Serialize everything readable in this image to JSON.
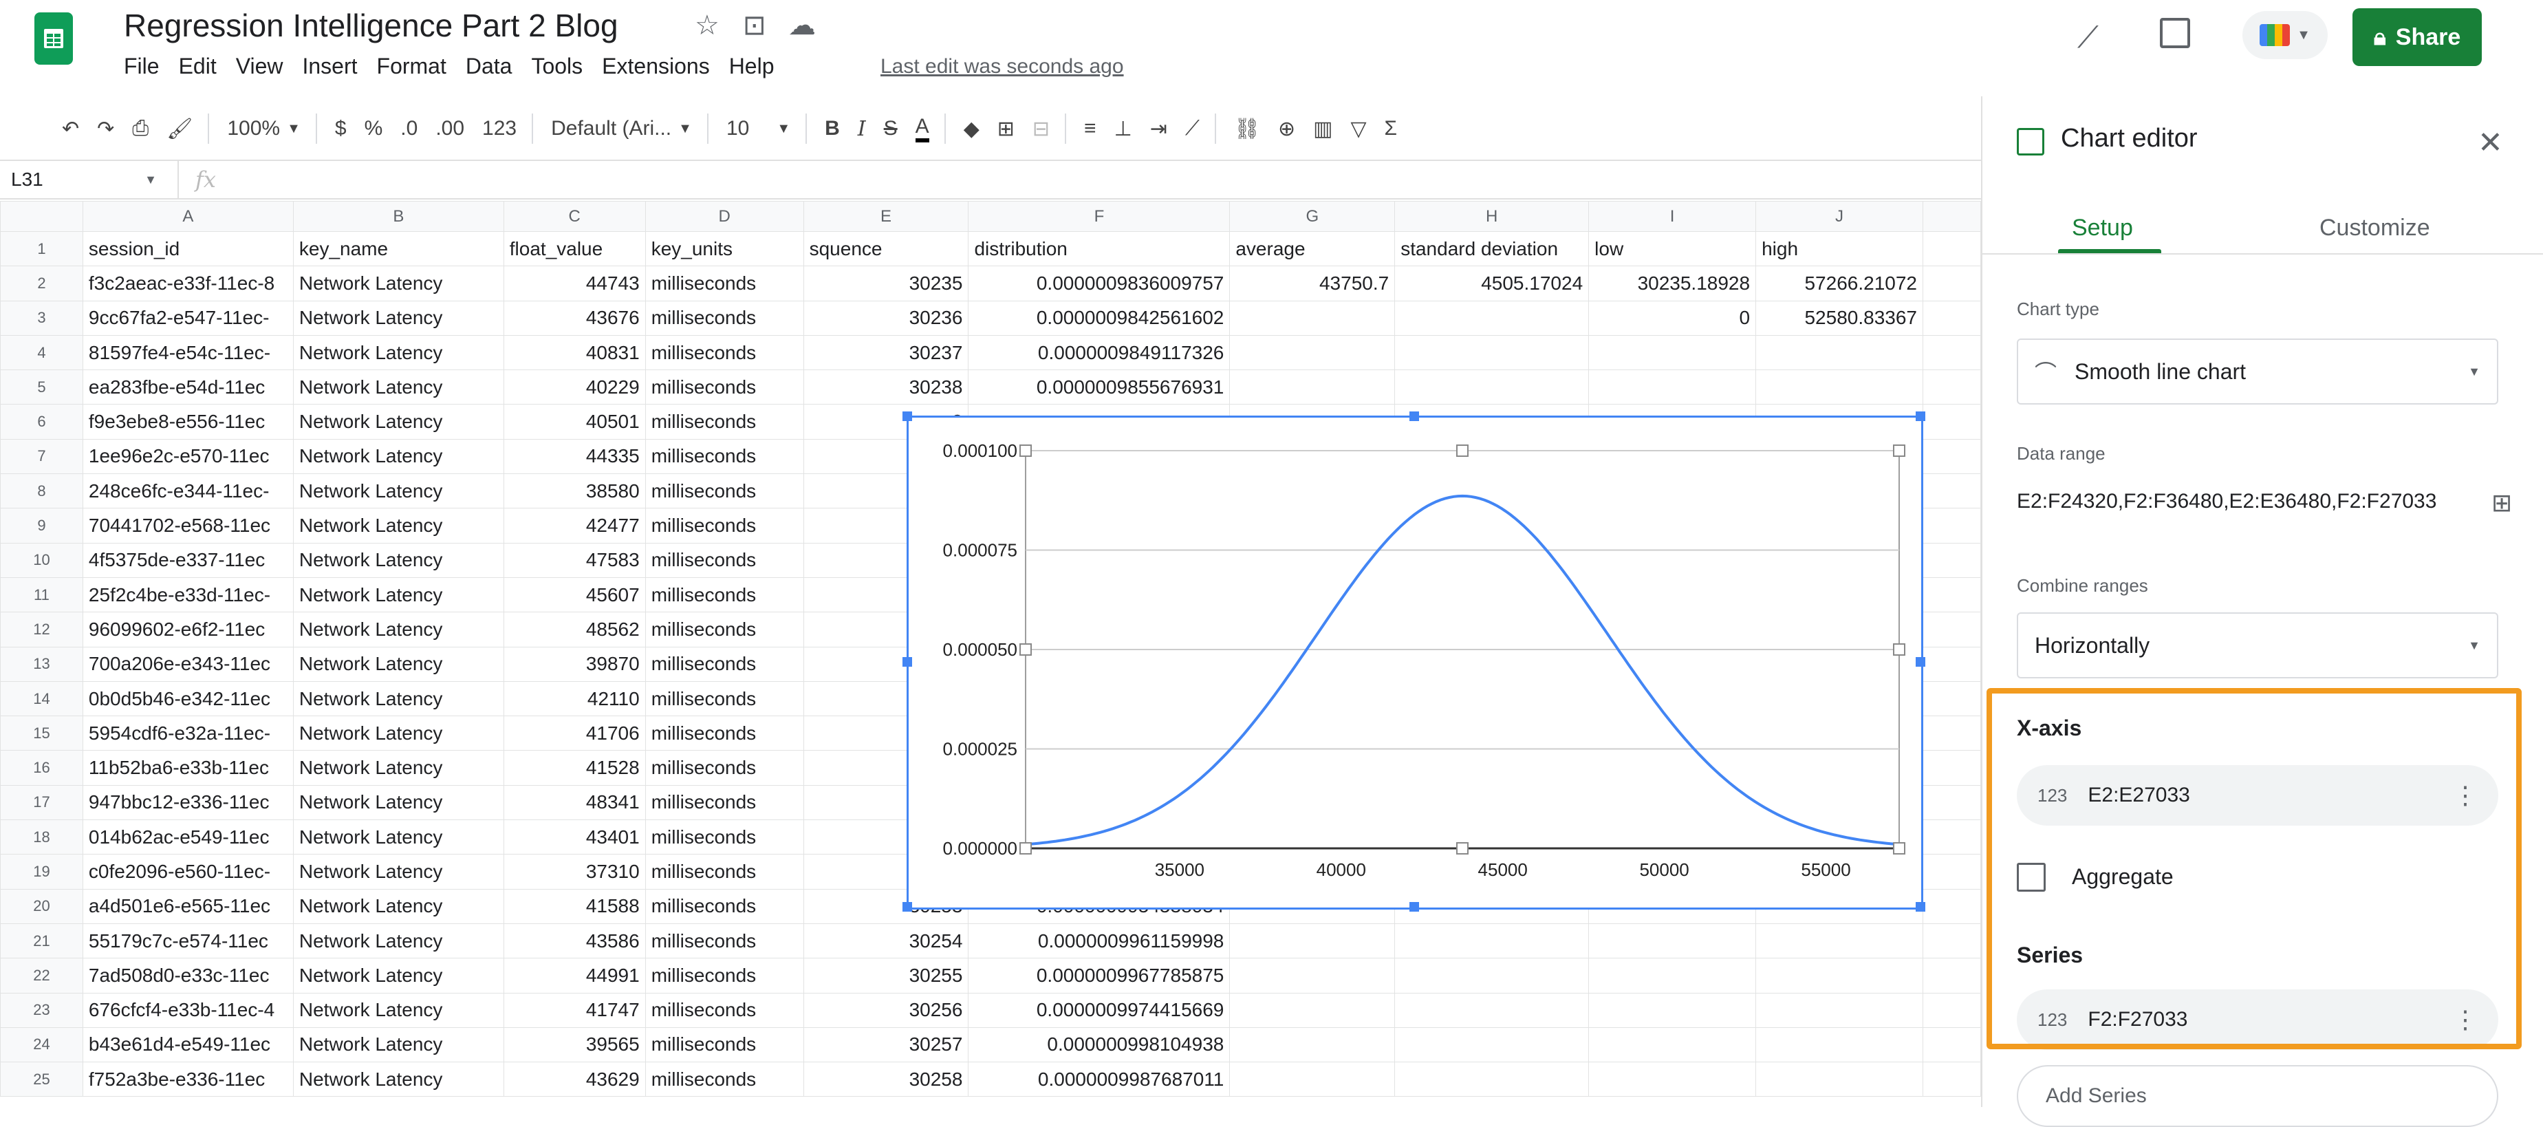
{
  "header": {
    "title": "Regression Intelligence Part 2 Blog",
    "menus": [
      "File",
      "Edit",
      "View",
      "Insert",
      "Format",
      "Data",
      "Tools",
      "Extensions",
      "Help"
    ],
    "last_edit": "Last edit was seconds ago",
    "share_label": "Share"
  },
  "toolbar": {
    "zoom": "100%",
    "currency": "$",
    "percent": "%",
    "dec_decrease": ".0",
    "dec_increase": ".00",
    "number_format": "123",
    "font": "Default (Ari...",
    "font_size": "10"
  },
  "formula_bar": {
    "cell_ref": "L31",
    "fx": "fx"
  },
  "sheet": {
    "columns": [
      "A",
      "B",
      "C",
      "D",
      "E",
      "F",
      "G",
      "H",
      "I",
      "J"
    ],
    "headers": [
      "session_id",
      "key_name",
      "float_value",
      "key_units",
      "squence",
      "distribution",
      "average",
      "standard deviation",
      "low",
      "high"
    ],
    "rows": [
      [
        "f3c2aeac-e33f-11ec-8",
        "Network Latency",
        "44743",
        "milliseconds",
        "30235",
        "0.0000009836009757",
        "43750.7",
        "4505.17024",
        "30235.18928",
        "57266.21072"
      ],
      [
        "9cc67fa2-e547-11ec-",
        "Network Latency",
        "43676",
        "milliseconds",
        "30236",
        "0.0000009842561602",
        "",
        "",
        "0",
        "52580.83367"
      ],
      [
        "81597fe4-e54c-11ec-",
        "Network Latency",
        "40831",
        "milliseconds",
        "30237",
        "0.0000009849117326",
        "",
        "",
        "",
        ""
      ],
      [
        "ea283fbe-e54d-11ec",
        "Network Latency",
        "40229",
        "milliseconds",
        "30238",
        "0.0000009855676931",
        "",
        "",
        "",
        ""
      ],
      [
        "f9e3ebe8-e556-11ec",
        "Network Latency",
        "40501",
        "milliseconds",
        "3",
        "",
        "",
        "",
        "",
        ""
      ],
      [
        "1ee96e2c-e570-11ec",
        "Network Latency",
        "44335",
        "milliseconds",
        "3",
        "",
        "",
        "",
        "",
        ""
      ],
      [
        "248ce6fc-e344-11ec-",
        "Network Latency",
        "38580",
        "milliseconds",
        "3",
        "",
        "",
        "",
        "",
        ""
      ],
      [
        "70441702-e568-11ec",
        "Network Latency",
        "42477",
        "milliseconds",
        "3",
        "",
        "",
        "",
        "",
        ""
      ],
      [
        "4f5375de-e337-11ec",
        "Network Latency",
        "47583",
        "milliseconds",
        "3",
        "",
        "",
        "",
        "",
        ""
      ],
      [
        "25f2c4be-e33d-11ec-",
        "Network Latency",
        "45607",
        "milliseconds",
        "3",
        "",
        "",
        "",
        "",
        ""
      ],
      [
        "96099602-e6f2-11ec",
        "Network Latency",
        "48562",
        "milliseconds",
        "3",
        "",
        "",
        "",
        "",
        ""
      ],
      [
        "700a206e-e343-11ec",
        "Network Latency",
        "39870",
        "milliseconds",
        "3",
        "",
        "",
        "",
        "",
        ""
      ],
      [
        "0b0d5b46-e342-11ec",
        "Network Latency",
        "42110",
        "milliseconds",
        "3",
        "",
        "",
        "",
        "",
        ""
      ],
      [
        "5954cdf6-e32a-11ec-",
        "Network Latency",
        "41706",
        "milliseconds",
        "3",
        "",
        "",
        "",
        "",
        ""
      ],
      [
        "11b52ba6-e33b-11ec",
        "Network Latency",
        "41528",
        "milliseconds",
        "3",
        "",
        "",
        "",
        "",
        ""
      ],
      [
        "947bbc12-e336-11ec",
        "Network Latency",
        "48341",
        "milliseconds",
        "3",
        "",
        "",
        "",
        "",
        ""
      ],
      [
        "014b62ac-e549-11ec",
        "Network Latency",
        "43401",
        "milliseconds",
        "3",
        "",
        "",
        "",
        "",
        ""
      ],
      [
        "c0fe2096-e560-11ec-",
        "Network Latency",
        "37310",
        "milliseconds",
        "3",
        "",
        "",
        "",
        "",
        ""
      ],
      [
        "a4d501e6-e565-11ec",
        "Network Latency",
        "41588",
        "milliseconds",
        "30253",
        "0.0000009954538034",
        "",
        "",
        "",
        ""
      ],
      [
        "55179c7c-e574-11ec",
        "Network Latency",
        "43586",
        "milliseconds",
        "30254",
        "0.0000009961159998",
        "",
        "",
        "",
        ""
      ],
      [
        "7ad508d0-e33c-11ec",
        "Network Latency",
        "44991",
        "milliseconds",
        "30255",
        "0.0000009967785875",
        "",
        "",
        "",
        ""
      ],
      [
        "676cfcf4-e33b-11ec-4",
        "Network Latency",
        "41747",
        "milliseconds",
        "30256",
        "0.0000009974415669",
        "",
        "",
        "",
        ""
      ],
      [
        "b43e61d4-e549-11ec",
        "Network Latency",
        "39565",
        "milliseconds",
        "30257",
        "0.000000998104938",
        "",
        "",
        "",
        ""
      ],
      [
        "f752a3be-e336-11ec",
        "Network Latency",
        "43629",
        "milliseconds",
        "30258",
        "0.0000009987687011",
        "",
        "",
        "",
        ""
      ]
    ]
  },
  "chart_data": {
    "type": "line",
    "title": "",
    "xlabel": "",
    "ylabel": "",
    "xlim": [
      30235,
      57266
    ],
    "ylim": [
      0,
      0.0001
    ],
    "x_ticks": [
      "35000",
      "40000",
      "45000",
      "50000",
      "55000"
    ],
    "y_ticks": [
      "0.000000",
      "0.000025",
      "0.000050",
      "0.000075",
      "0.000100"
    ],
    "series": [
      {
        "color": "#4285f4",
        "mean": 43750.7,
        "std": 4505.17024,
        "x": [
          30235,
          32000,
          34000,
          36000,
          38000,
          40000,
          41000,
          42000,
          43000,
          43750,
          44500,
          45500,
          46500,
          48000,
          50000,
          52000,
          54000,
          56000,
          57266
        ],
        "y": [
          9.8e-07,
          2.4e-06,
          8.4e-06,
          2.01e-05,
          3.88e-05,
          6.23e-05,
          7.34e-05,
          8.22e-05,
          8.72e-05,
          8.86e-05,
          8.72e-05,
          8.17e-05,
          7.33e-05,
          5.65e-05,
          3.38e-05,
          1.66e-05,
          6.6e-06,
          2.1e-06,
          9.8e-07
        ]
      }
    ],
    "grid": true,
    "legend": "none"
  },
  "sidebar": {
    "title": "Chart editor",
    "tabs": {
      "setup": "Setup",
      "customize": "Customize"
    },
    "chart_type_label": "Chart type",
    "chart_type_value": "Smooth line chart",
    "data_range_label": "Data range",
    "data_range_value": "E2:F24320,F2:F36480,E2:E36480,F2:F27033",
    "combine_label": "Combine ranges",
    "combine_value": "Horizontally",
    "x_axis_label": "X-axis",
    "x_axis_range": "E2:E27033",
    "x_axis_type": "123",
    "aggregate_label": "Aggregate",
    "series_label": "Series",
    "series_range": "F2:F27033",
    "series_type": "123",
    "add_series": "Add Series",
    "highlight_color": "#f29b1f"
  }
}
